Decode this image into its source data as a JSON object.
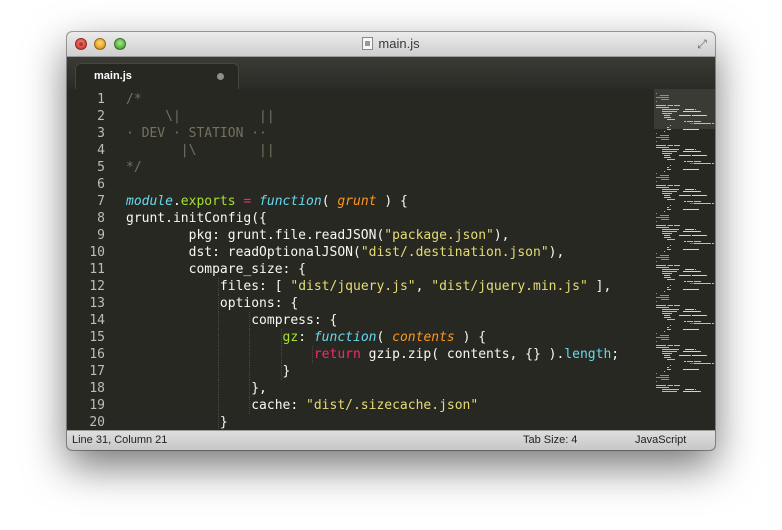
{
  "window": {
    "title": "main.js",
    "controls": [
      "close-icon",
      "minimize-icon",
      "zoom-icon"
    ],
    "fullscreen_icon": "fullscreen-icon"
  },
  "tabs": [
    {
      "label": "main.js",
      "dirty": true,
      "active": true
    }
  ],
  "editor": {
    "line_numbers": [
      "1",
      "2",
      "3",
      "4",
      "5",
      "6",
      "7",
      "8",
      "9",
      "10",
      "11",
      "12",
      "13",
      "14",
      "15",
      "16",
      "17",
      "18",
      "19",
      "20"
    ],
    "colors": {
      "background": "#272822",
      "comment": "#75715e",
      "string": "#e6db74",
      "keyword": "#f92672",
      "function": "#66d9ef",
      "parameter": "#fd971f",
      "property": "#a6e22e"
    },
    "lines": [
      [
        {
          "t": "/*",
          "c": "c"
        }
      ],
      [
        {
          "t": "     \\|          ||",
          "c": "c"
        }
      ],
      [
        {
          "t": "· DEV · STATION ··",
          "c": "c"
        }
      ],
      [
        {
          "t": "       |\\        ||",
          "c": "c"
        }
      ],
      [
        {
          "t": "*/",
          "c": "c"
        }
      ],
      [],
      [
        {
          "t": "module",
          "c": "f"
        },
        {
          "t": ".",
          "c": ""
        },
        {
          "t": "exports",
          "c": "g"
        },
        {
          "t": " ",
          "c": ""
        },
        {
          "t": "=",
          "c": "k"
        },
        {
          "t": " ",
          "c": ""
        },
        {
          "t": "function",
          "c": "f"
        },
        {
          "t": "( ",
          "c": ""
        },
        {
          "t": "grunt",
          "c": "p"
        },
        {
          "t": " ) {",
          "c": ""
        }
      ],
      [
        {
          "t": "grunt.initConfig({",
          "c": ""
        }
      ],
      [
        {
          "t": "        pkg: grunt.file.readJSON(",
          "c": ""
        },
        {
          "t": "\"package.json\"",
          "c": "s"
        },
        {
          "t": "),",
          "c": ""
        }
      ],
      [
        {
          "t": "        dst: readOptionalJSON(",
          "c": ""
        },
        {
          "t": "\"dist/.destination.json\"",
          "c": "s"
        },
        {
          "t": "),",
          "c": ""
        }
      ],
      [
        {
          "t": "        compare_size: {",
          "c": ""
        }
      ],
      [
        {
          "t": "            files: [ ",
          "c": ""
        },
        {
          "t": "\"dist/jquery.js\"",
          "c": "s"
        },
        {
          "t": ", ",
          "c": ""
        },
        {
          "t": "\"dist/jquery.min.js\"",
          "c": "s"
        },
        {
          "t": " ],",
          "c": ""
        }
      ],
      [
        {
          "t": "            options: {",
          "c": ""
        }
      ],
      [
        {
          "t": "                compress: {",
          "c": ""
        }
      ],
      [
        {
          "t": "                    ",
          "c": ""
        },
        {
          "t": "gz",
          "c": "g"
        },
        {
          "t": ": ",
          "c": ""
        },
        {
          "t": "function",
          "c": "f"
        },
        {
          "t": "( ",
          "c": ""
        },
        {
          "t": "contents",
          "c": "p"
        },
        {
          "t": " ) {",
          "c": ""
        }
      ],
      [
        {
          "t": "                        ",
          "c": ""
        },
        {
          "t": "return",
          "c": "k"
        },
        {
          "t": " gzip.zip( contents, {} ).",
          "c": ""
        },
        {
          "t": "length",
          "c": "b"
        },
        {
          "t": ";",
          "c": ""
        }
      ],
      [
        {
          "t": "                    }",
          "c": ""
        }
      ],
      [
        {
          "t": "                },",
          "c": ""
        }
      ],
      [
        {
          "t": "                cache: ",
          "c": ""
        },
        {
          "t": "\"dist/.sizecache.json\"",
          "c": "s"
        }
      ],
      [
        {
          "t": "            }",
          "c": ""
        }
      ]
    ]
  },
  "statusbar": {
    "position": "Line 31, Column 21",
    "tab_size": "Tab Size: 4",
    "syntax": "JavaScript"
  }
}
